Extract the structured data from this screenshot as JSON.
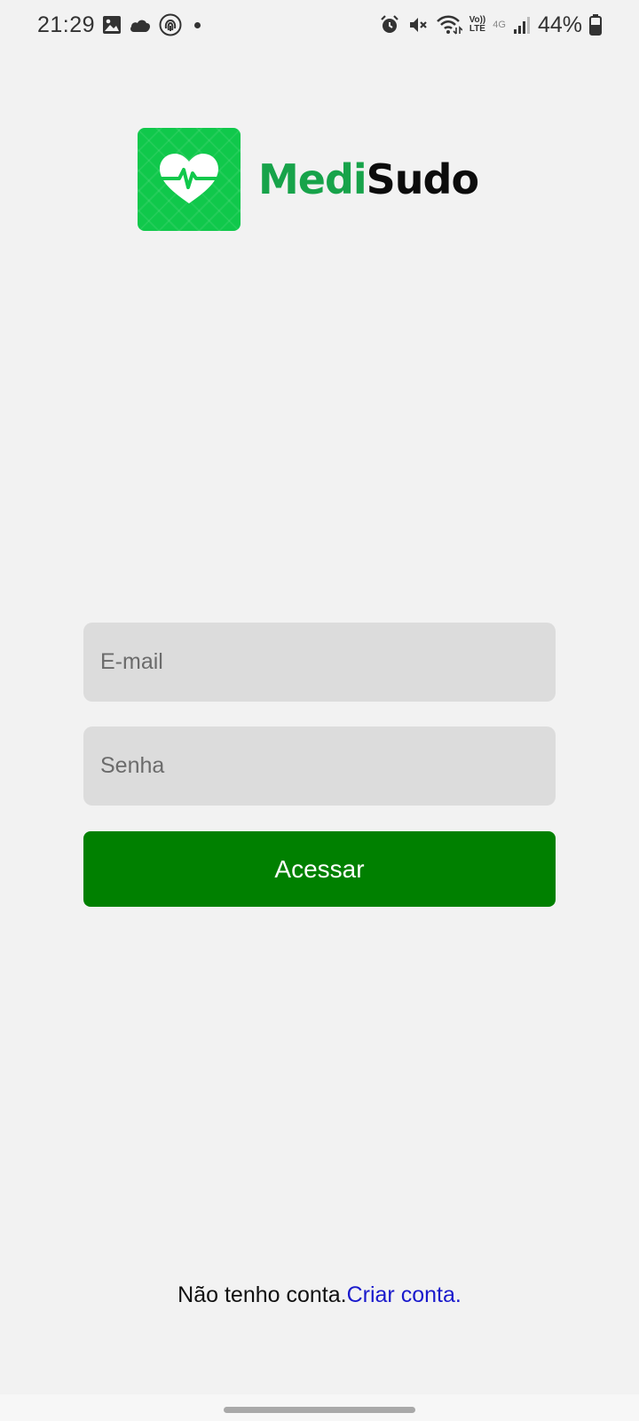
{
  "status_bar": {
    "time": "21:29",
    "battery_percent": "44%",
    "network_type": "4G",
    "volte_top": "Vo))",
    "volte_bottom": "LTE",
    "left_icons": [
      "image-icon",
      "cloud-icon",
      "fingerprint-icon",
      "dot-icon"
    ],
    "right_icons": [
      "alarm-icon",
      "mute-icon",
      "wifi-icon",
      "volte-icon",
      "signal-icon",
      "battery-icon"
    ]
  },
  "logo": {
    "part1": "Medi",
    "part2": "Sudo",
    "colors": {
      "tile": "#10c84b",
      "medi": "#17a34a",
      "sudo": "#0c0c0c"
    }
  },
  "form": {
    "email_placeholder": "E-mail",
    "password_placeholder": "Senha",
    "submit_label": "Acessar",
    "submit_color": "#008000"
  },
  "signup": {
    "text": "Não tenho conta.",
    "link": "Criar conta.",
    "link_color": "#1a1acc"
  }
}
